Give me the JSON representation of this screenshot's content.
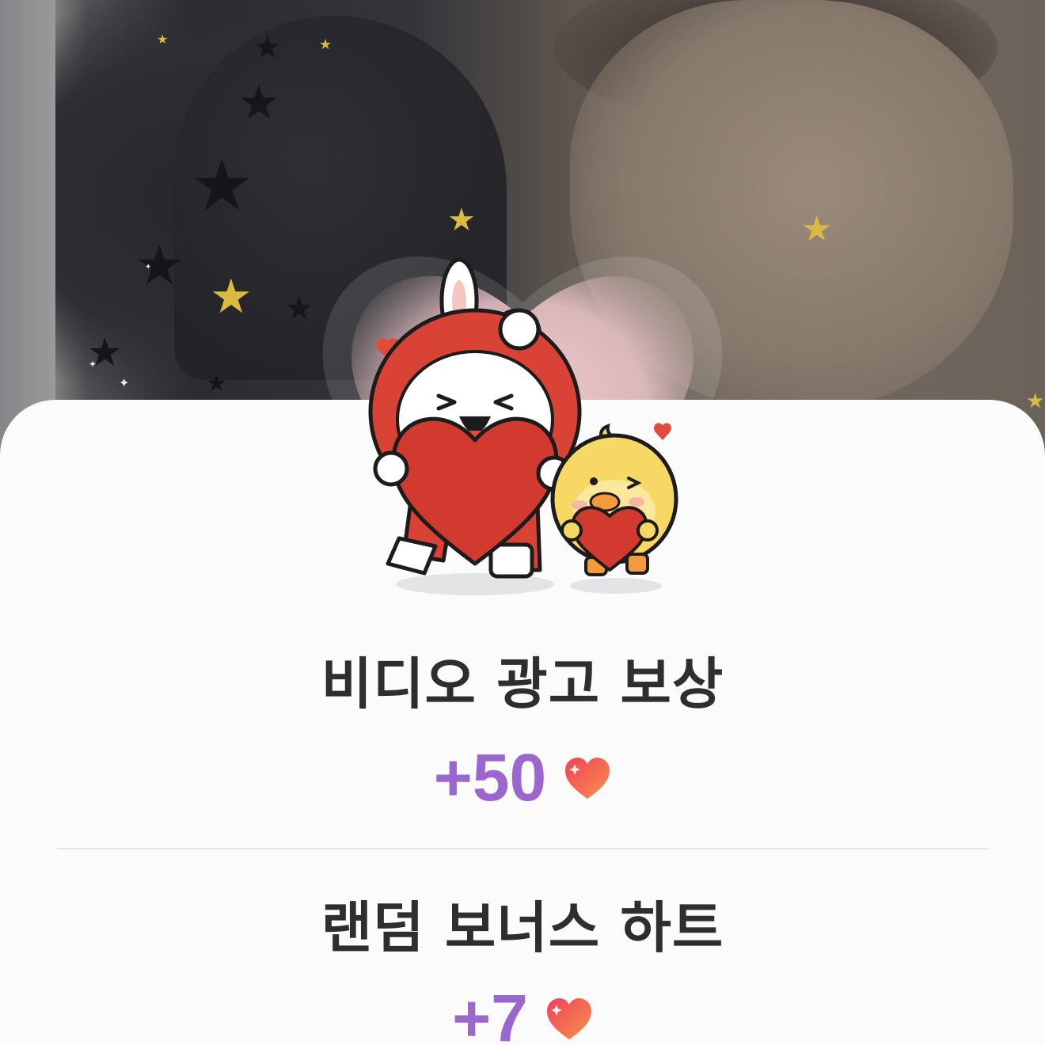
{
  "reward_dialog": {
    "items": [
      {
        "title": "비디오 광고 보상",
        "amount": "+50",
        "currency_icon": "heart-icon"
      },
      {
        "title": "랜덤 보너스 하트",
        "amount": "+7",
        "currency_icon": "heart-icon"
      }
    ],
    "illustration": "rabbit-and-chick-holding-hearts",
    "colors": {
      "amount": "#9b67cf",
      "title": "#2e2e31",
      "heart": "#f2584a",
      "sheet": "#fbfbfc"
    }
  }
}
